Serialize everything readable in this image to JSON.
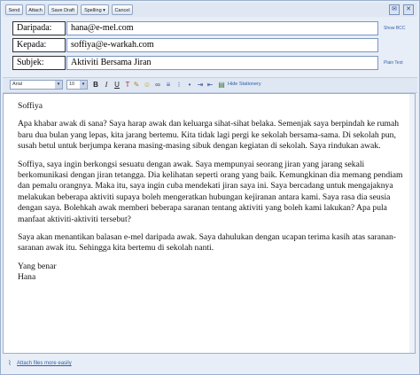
{
  "toolbar": {
    "send": "Send",
    "attach": "Attach",
    "save_draft": "Save Draft",
    "spelling": "Spelling",
    "cancel": "Cancel"
  },
  "header": {
    "from_label": "Daripada:",
    "from_value": "hana@e-mel.com",
    "to_label": "Kepada:",
    "to_value": "soffiya@e-warkah.com",
    "subject_label": "Subjek:",
    "subject_value": "Aktiviti Bersama Jiran",
    "show_bcc": "Show BCC",
    "plain_text": "Plain Text"
  },
  "format": {
    "font": "Arial",
    "size": "10",
    "hide_stationery": "Hide Stationery"
  },
  "message": {
    "greeting": "Soffiya",
    "p1": "Apa khabar awak di sana? Saya harap awak dan keluarga sihat-sihat belaka. Semenjak saya berpindah ke rumah baru dua bulan yang lepas, kita jarang bertemu. Kita tidak lagi pergi ke sekolah bersama-sama. Di sekolah pun, susah betul untuk berjumpa kerana masing-masing sibuk dengan kegiatan di sekolah. Saya rindukan awak.",
    "p2": "Soffiya, saya ingin berkongsi sesuatu dengan awak. Saya mempunyai seorang jiran yang jarang sekali berkomunikasi dengan jiran tetangga. Dia kelihatan seperti orang yang baik. Kemungkinan dia memang pendiam dan pemalu orangnya. Maka itu, saya ingin cuba mendekati jiran saya ini. Saya bercadang untuk mengajaknya melakukan beberapa aktiviti supaya boleh mengeratkan hubungan kejiranan antara kami. Saya rasa dia seusia dengan saya. Bolehkah awak memberi beberapa saranan tentang aktiviti yang boleh kami lakukan? Apa pula manfaat aktiviti-aktiviti tersebut?",
    "p3": "Saya akan menantikan balasan e-mel daripada awak. Saya dahulukan dengan ucapan terima kasih atas saranan-saranan awak itu. Sehingga kita bertemu di sekolah nanti.",
    "closing": "Yang benar",
    "signature": "Hana"
  },
  "footer": {
    "attach_link": "Attach files more easily"
  },
  "colors": {
    "toolbar_bg": "#dfe7f3",
    "link": "#2f5ea8",
    "border": "#9bb0cc"
  }
}
